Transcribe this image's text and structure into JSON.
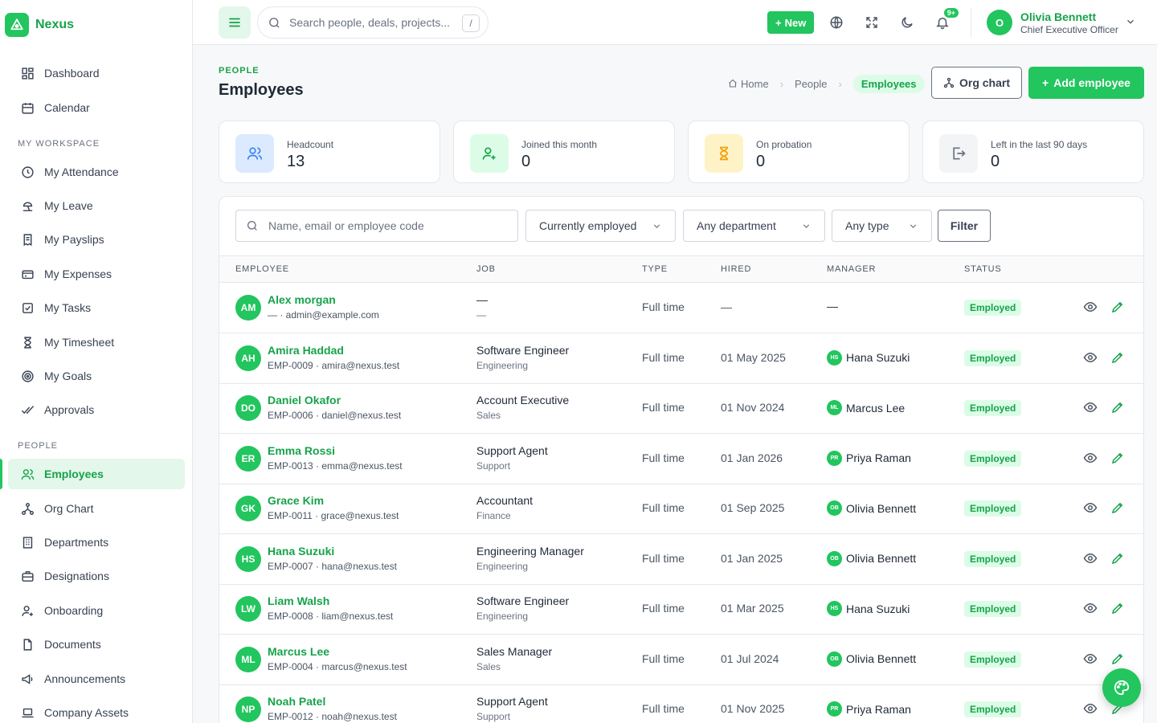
{
  "app": {
    "name": "Nexus"
  },
  "sidebar": {
    "top": [
      {
        "label": "Dashboard",
        "icon": "dashboard-icon"
      },
      {
        "label": "Calendar",
        "icon": "calendar-icon"
      }
    ],
    "workspace_title": "MY WORKSPACE",
    "workspace": [
      {
        "label": "My Attendance",
        "icon": "clock-icon"
      },
      {
        "label": "My Leave",
        "icon": "beach-icon"
      },
      {
        "label": "My Payslips",
        "icon": "receipt-icon"
      },
      {
        "label": "My Expenses",
        "icon": "wallet-icon"
      },
      {
        "label": "My Tasks",
        "icon": "checkbox-icon"
      },
      {
        "label": "My Timesheet",
        "icon": "hourglass-icon"
      },
      {
        "label": "My Goals",
        "icon": "target-icon"
      },
      {
        "label": "Approvals",
        "icon": "double-check-icon"
      }
    ],
    "people_title": "PEOPLE",
    "people": [
      {
        "label": "Employees",
        "icon": "users-icon",
        "active": true
      },
      {
        "label": "Org Chart",
        "icon": "org-chart-icon"
      },
      {
        "label": "Departments",
        "icon": "building-icon"
      },
      {
        "label": "Designations",
        "icon": "briefcase-icon"
      },
      {
        "label": "Onboarding",
        "icon": "user-plus-icon"
      },
      {
        "label": "Documents",
        "icon": "document-icon"
      },
      {
        "label": "Announcements",
        "icon": "megaphone-icon"
      },
      {
        "label": "Company Assets",
        "icon": "laptop-icon"
      }
    ]
  },
  "topbar": {
    "search_placeholder": "Search people, deals, projects...",
    "search_shortcut": "/",
    "new_label": "New",
    "notif_badge": "9+",
    "user": {
      "initial": "O",
      "name": "Olivia Bennett",
      "role": "Chief Executive Officer"
    }
  },
  "page": {
    "eyebrow": "PEOPLE",
    "title": "Employees",
    "breadcrumb": [
      "Home",
      "People",
      "Employees"
    ],
    "org_chart_label": "Org chart",
    "add_label": "Add employee"
  },
  "stats": [
    {
      "label": "Headcount",
      "value": "13",
      "icon": "users-icon",
      "bg": "#dbeafe",
      "fg": "#3b82f6"
    },
    {
      "label": "Joined this month",
      "value": "0",
      "icon": "user-plus-icon",
      "bg": "#dcfce7",
      "fg": "#16a34a"
    },
    {
      "label": "On probation",
      "value": "0",
      "icon": "hourglass-icon",
      "bg": "#fef3c7",
      "fg": "#f59e0b"
    },
    {
      "label": "Left in the last 90 days",
      "value": "0",
      "icon": "exit-icon",
      "bg": "#f3f4f6",
      "fg": "#6b7280"
    }
  ],
  "filters": {
    "search_placeholder": "Name, email or employee code",
    "status": "Currently employed",
    "department": "Any department",
    "type": "Any type",
    "filter_label": "Filter"
  },
  "table": {
    "columns": [
      "EMPLOYEE",
      "JOB",
      "TYPE",
      "HIRED",
      "MANAGER",
      "STATUS"
    ],
    "rows": [
      {
        "initials": "AM",
        "name": "Alex morgan",
        "sub": "— · admin@example.com",
        "job": "—",
        "dept": "—",
        "type": "Full time",
        "hired": "—",
        "manager": "—",
        "mgr_initials": "",
        "status": "Employed"
      },
      {
        "initials": "AH",
        "name": "Amira Haddad",
        "sub": "EMP-0009 · amira@nexus.test",
        "job": "Software Engineer",
        "dept": "Engineering",
        "type": "Full time",
        "hired": "01 May 2025",
        "manager": "Hana Suzuki",
        "mgr_initials": "HS",
        "status": "Employed"
      },
      {
        "initials": "DO",
        "name": "Daniel Okafor",
        "sub": "EMP-0006 · daniel@nexus.test",
        "job": "Account Executive",
        "dept": "Sales",
        "type": "Full time",
        "hired": "01 Nov 2024",
        "manager": "Marcus Lee",
        "mgr_initials": "ML",
        "status": "Employed"
      },
      {
        "initials": "ER",
        "name": "Emma Rossi",
        "sub": "EMP-0013 · emma@nexus.test",
        "job": "Support Agent",
        "dept": "Support",
        "type": "Full time",
        "hired": "01 Jan 2026",
        "manager": "Priya Raman",
        "mgr_initials": "PR",
        "status": "Employed"
      },
      {
        "initials": "GK",
        "name": "Grace Kim",
        "sub": "EMP-0011 · grace@nexus.test",
        "job": "Accountant",
        "dept": "Finance",
        "type": "Full time",
        "hired": "01 Sep 2025",
        "manager": "Olivia Bennett",
        "mgr_initials": "OB",
        "status": "Employed"
      },
      {
        "initials": "HS",
        "name": "Hana Suzuki",
        "sub": "EMP-0007 · hana@nexus.test",
        "job": "Engineering Manager",
        "dept": "Engineering",
        "type": "Full time",
        "hired": "01 Jan 2025",
        "manager": "Olivia Bennett",
        "mgr_initials": "OB",
        "status": "Employed"
      },
      {
        "initials": "LW",
        "name": "Liam Walsh",
        "sub": "EMP-0008 · liam@nexus.test",
        "job": "Software Engineer",
        "dept": "Engineering",
        "type": "Full time",
        "hired": "01 Mar 2025",
        "manager": "Hana Suzuki",
        "mgr_initials": "HS",
        "status": "Employed"
      },
      {
        "initials": "ML",
        "name": "Marcus Lee",
        "sub": "EMP-0004 · marcus@nexus.test",
        "job": "Sales Manager",
        "dept": "Sales",
        "type": "Full time",
        "hired": "01 Jul 2024",
        "manager": "Olivia Bennett",
        "mgr_initials": "OB",
        "status": "Employed"
      },
      {
        "initials": "NP",
        "name": "Noah Patel",
        "sub": "EMP-0012 · noah@nexus.test",
        "job": "Support Agent",
        "dept": "Support",
        "type": "Full time",
        "hired": "01 Nov 2025",
        "manager": "Priya Raman",
        "mgr_initials": "PR",
        "status": "Employed"
      }
    ]
  },
  "colors": {
    "accent": "#22c55e",
    "accent_dark": "#16a34a",
    "accent_light": "#dcfce7"
  }
}
